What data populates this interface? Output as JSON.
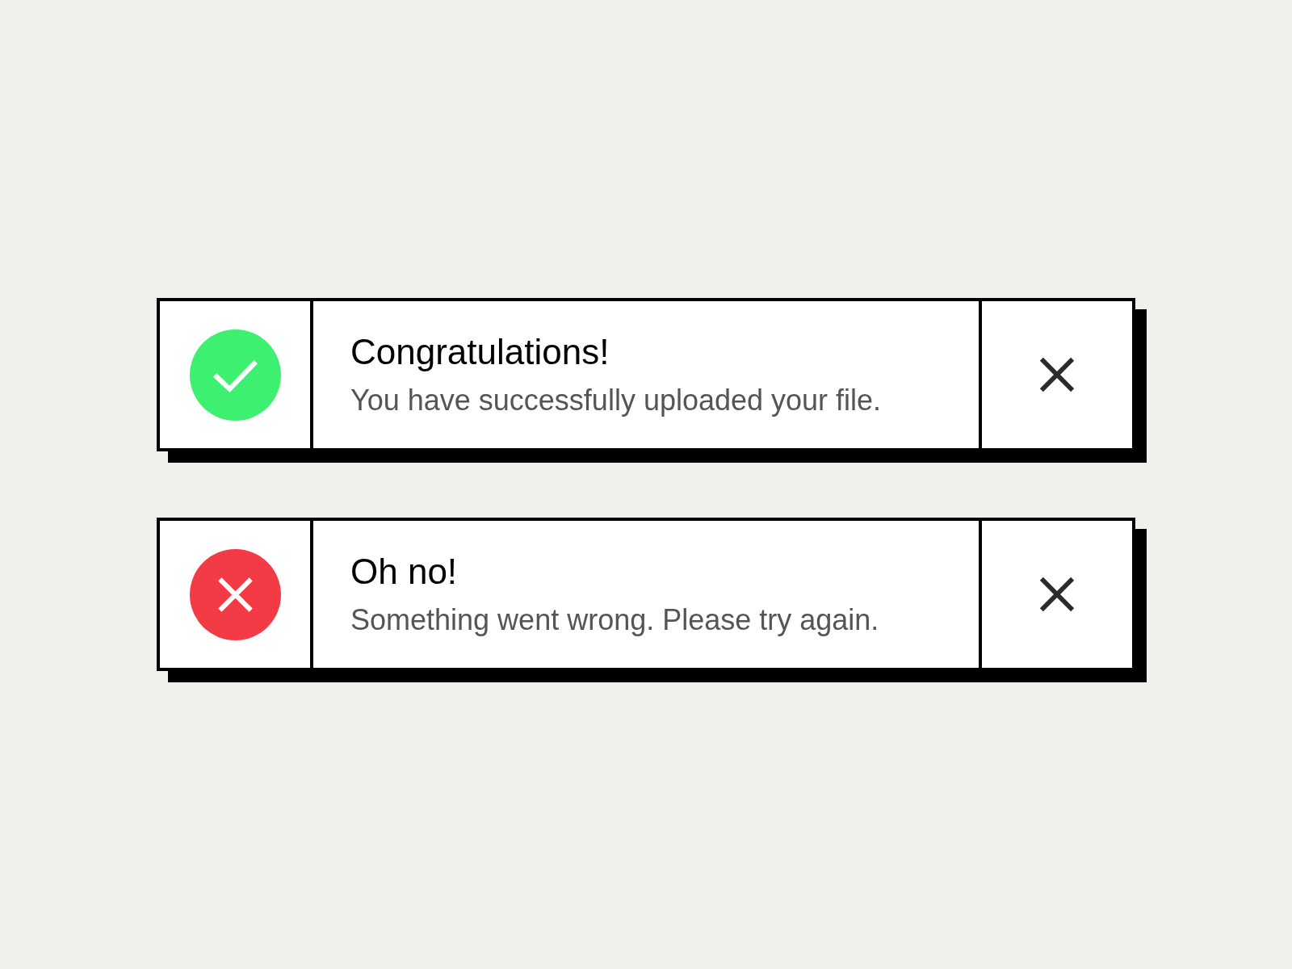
{
  "toasts": [
    {
      "kind": "success",
      "title": "Congratulations!",
      "message": "You have successfully uploaded your file."
    },
    {
      "kind": "error",
      "title": "Oh no!",
      "message": "Something went wrong. Please try again."
    }
  ]
}
